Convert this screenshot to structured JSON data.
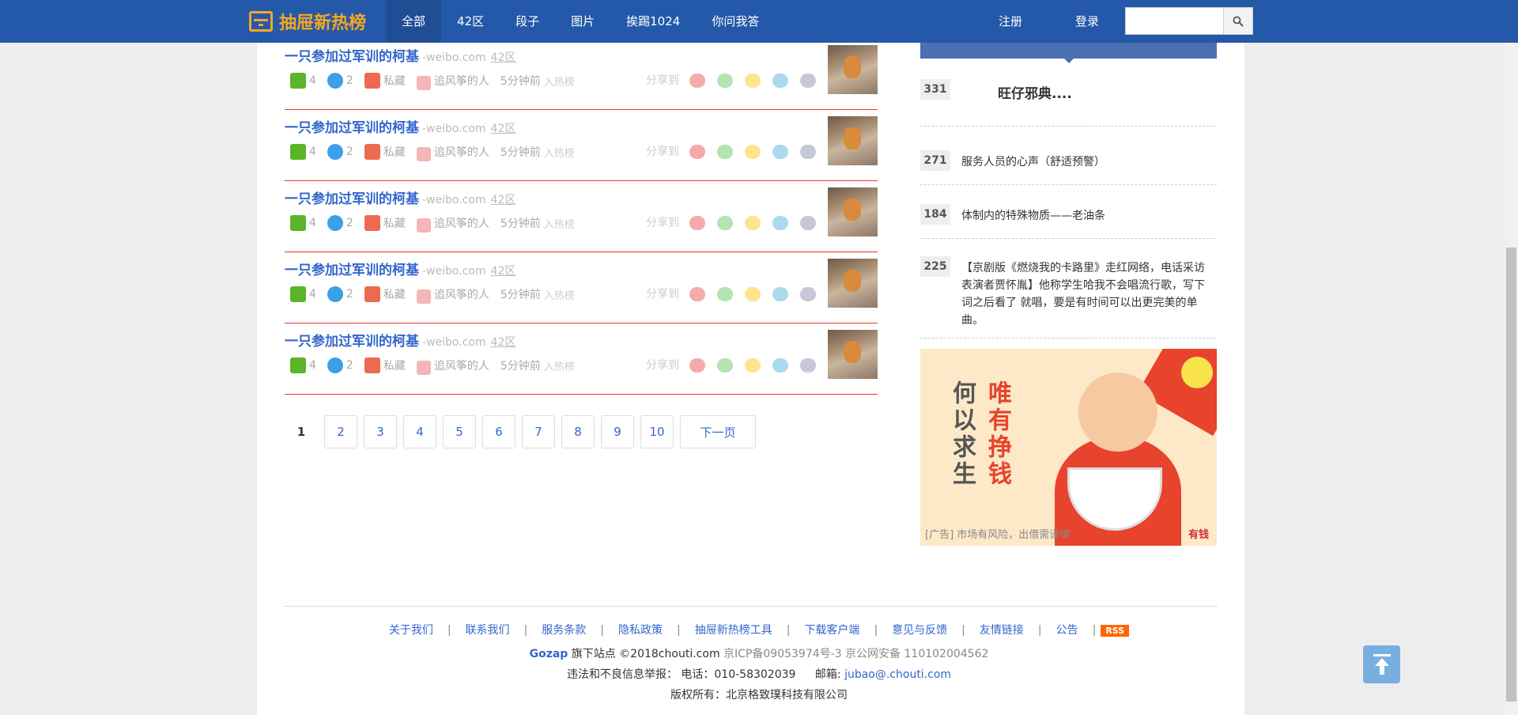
{
  "header": {
    "logo": "抽屉新热榜",
    "nav": [
      "全部",
      "42区",
      "段子",
      "图片",
      "挨踢1024",
      "你问我答"
    ],
    "register": "注册",
    "login": "登录",
    "search_placeholder": ""
  },
  "items": [
    {
      "title": "一只参加过军训的柯基",
      "domain": "-weibo.com",
      "zone": "42区",
      "likes": "4",
      "comments": "2",
      "fav": "私藏",
      "author": "追风筝的人",
      "time": "5分钟前",
      "hot": "入热榜",
      "share": "分享到"
    },
    {
      "title": "一只参加过军训的柯基",
      "domain": "-weibo.com",
      "zone": "42区",
      "likes": "4",
      "comments": "2",
      "fav": "私藏",
      "author": "追风筝的人",
      "time": "5分钟前",
      "hot": "入热榜",
      "share": "分享到"
    },
    {
      "title": "一只参加过军训的柯基",
      "domain": "-weibo.com",
      "zone": "42区",
      "likes": "4",
      "comments": "2",
      "fav": "私藏",
      "author": "追风筝的人",
      "time": "5分钟前",
      "hot": "入热榜",
      "share": "分享到"
    },
    {
      "title": "一只参加过军训的柯基",
      "domain": "-weibo.com",
      "zone": "42区",
      "likes": "4",
      "comments": "2",
      "fav": "私藏",
      "author": "追风筝的人",
      "time": "5分钟前",
      "hot": "入热榜",
      "share": "分享到"
    },
    {
      "title": "一只参加过军训的柯基",
      "domain": "-weibo.com",
      "zone": "42区",
      "likes": "4",
      "comments": "2",
      "fav": "私藏",
      "author": "追风筝的人",
      "time": "5分钟前",
      "hot": "入热榜",
      "share": "分享到"
    }
  ],
  "pager": {
    "pages": [
      "1",
      "2",
      "3",
      "4",
      "5",
      "6",
      "7",
      "8",
      "9",
      "10"
    ],
    "next": "下一页"
  },
  "sidebar": {
    "ranks": [
      {
        "num": "331",
        "text": "旺仔邪典...."
      },
      {
        "num": "271",
        "text": "服务人员的心声（舒适预警）"
      },
      {
        "num": "184",
        "text": "体制内的特殊物质——老油条"
      },
      {
        "num": "225",
        "text": "【京剧版《燃烧我的卡路里》走红网络，电话采访表演者贾怀胤】他称学生哈我不会唱流行歌，写下词之后看了 就唱，要是有时间可以出更完美的单曲。"
      }
    ],
    "ad": {
      "line1": "何以求生",
      "line2": "唯有挣钱",
      "footer": "[广告] 市场有风险，出借需谨慎",
      "brand": "有钱"
    }
  },
  "footer": {
    "links": [
      "关于我们",
      "联系我们",
      "服务条款",
      "隐私政策",
      "抽屉新热榜工具",
      "下载客户端",
      "意见与反馈",
      "友情链接",
      "公告"
    ],
    "rss": "RSS",
    "gozap": "Gozap",
    "site": "旗下站点 ©2018chouti.com",
    "icp": "京ICP备09053974号-3 京公网安备 110102004562",
    "report": "违法和不良信息举报：  电话：010-58302039",
    "mail_label": "邮箱:",
    "mail": "jubao@.chouti.com",
    "copyright": "版权所有：北京格致璞科技有限公司"
  },
  "colors": {
    "topbar": "#2459a9",
    "logo": "#f5a623",
    "link": "#3366cc",
    "divider": "#ee3333"
  }
}
